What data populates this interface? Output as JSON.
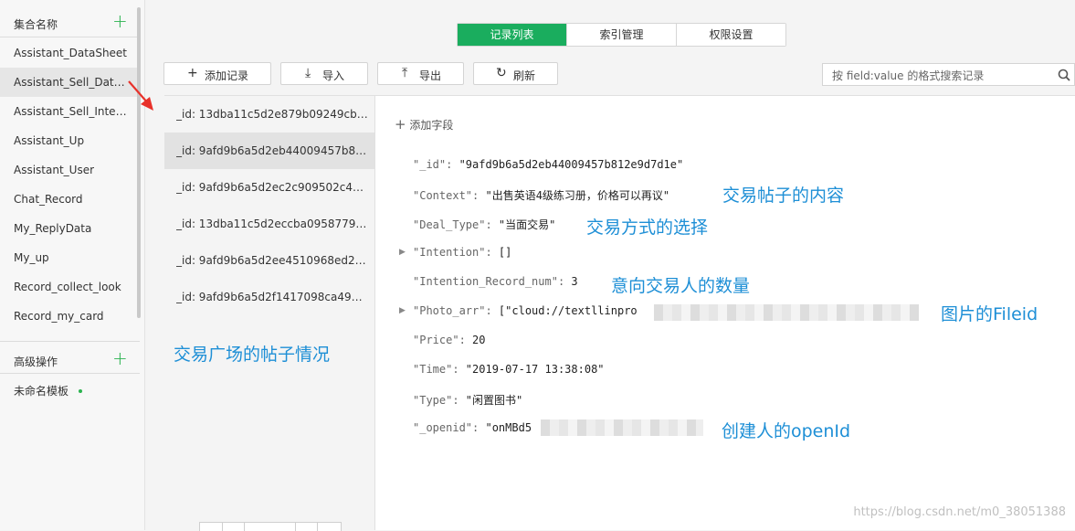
{
  "sidebar": {
    "collections_header": "集合名称",
    "add_icon": "plus-icon",
    "collections": [
      "Assistant_DataSheet",
      "Assistant_Sell_DataSheet",
      "Assistant_Sell_Intention",
      "Assistant_Up",
      "Assistant_User",
      "Chat_Record",
      "My_ReplyData",
      "My_up",
      "Record_collect_look",
      "Record_my_card"
    ],
    "advanced_header": "高级操作",
    "templates": [
      "未命名模板"
    ]
  },
  "tabs": [
    "记录列表",
    "索引管理",
    "权限设置"
  ],
  "toolbar": {
    "add": "添加记录",
    "import": "导入",
    "export": "导出",
    "refresh": "刷新"
  },
  "search": {
    "placeholder": "按 field:value 的格式搜索记录"
  },
  "records": [
    "_id: 13dba11c5d2e879b09249cbe7...",
    "_id: 9afd9b6a5d2eb44009457b812...",
    "_id: 9afd9b6a5d2ec2c909502c4036...",
    "_id: 13dba11c5d2eccba0958779e6...",
    "_id: 9afd9b6a5d2ee4510968ed264...",
    "_id: 9afd9b6a5d2f1417098ca4922a..."
  ],
  "detail": {
    "add_field": "添加字段",
    "fields": [
      {
        "key": "\"_id\": ",
        "value": "\"9afd9b6a5d2eb44009457b812e9d7d1e\""
      },
      {
        "key": "\"Context\": ",
        "value": "\"出售英语4级练习册，价格可以再议\""
      },
      {
        "key": "\"Deal_Type\": ",
        "value": "\"当面交易\""
      },
      {
        "key": "\"Intention\": ",
        "value": "[]"
      },
      {
        "key": "\"Intention_Record_num\": ",
        "value": "3"
      },
      {
        "key": "\"Photo_arr\": ",
        "value": "[\"cloud://textllinpro"
      },
      {
        "key": "\"Price\": ",
        "value": "20"
      },
      {
        "key": "\"Time\": ",
        "value": "\"2019-07-17 13:38:08\""
      },
      {
        "key": "\"Type\": ",
        "value": "\"闲置图书\""
      },
      {
        "key": "\"_openid\": ",
        "value": "\"onMBd5"
      }
    ]
  },
  "annotations": {
    "list_note": "交易广场的帖子情况",
    "context_note": "交易帖子的内容",
    "deal_note": "交易方式的选择",
    "intention_note": "意向交易人的数量",
    "photo_note": "图片的Fileid",
    "openid_note": "创建人的openId"
  },
  "watermark": "https://blog.csdn.net/m0_38051388",
  "colors": {
    "accent": "#1aad5e",
    "annotation": "#1e8fd6",
    "arrow": "#e8312a"
  }
}
